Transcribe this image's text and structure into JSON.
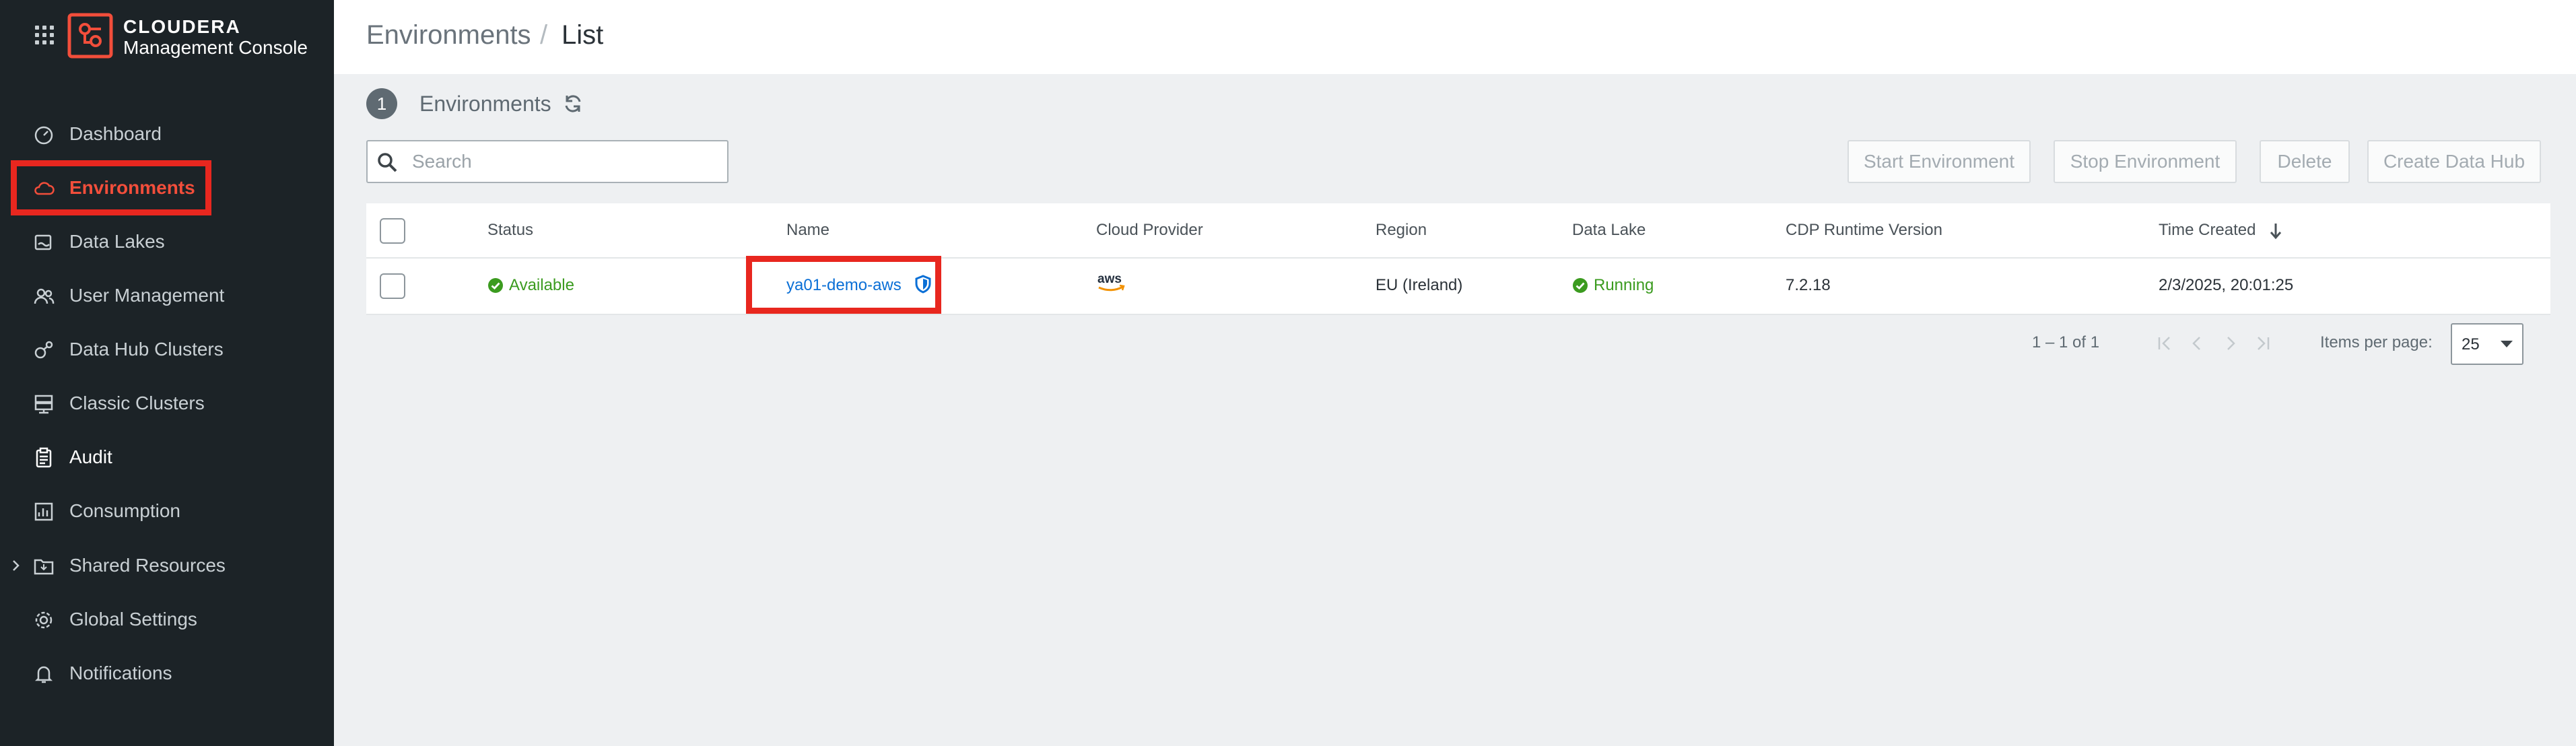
{
  "brand": {
    "name": "CLOUDERA",
    "subtitle": "Management Console"
  },
  "sidebar": {
    "items": [
      {
        "label": "Dashboard",
        "icon": "gauge-icon"
      },
      {
        "label": "Environments",
        "icon": "cloud-icon",
        "active": true
      },
      {
        "label": "Data Lakes",
        "icon": "data-lake-icon"
      },
      {
        "label": "User Management",
        "icon": "users-icon"
      },
      {
        "label": "Data Hub Clusters",
        "icon": "data-hub-icon"
      },
      {
        "label": "Classic Clusters",
        "icon": "server-icon"
      },
      {
        "label": "Audit",
        "icon": "clipboard-icon"
      },
      {
        "label": "Consumption",
        "icon": "chart-icon"
      },
      {
        "label": "Shared Resources",
        "icon": "folder-icon"
      },
      {
        "label": "Global Settings",
        "icon": "gear-icon"
      },
      {
        "label": "Notifications",
        "icon": "bell-icon"
      }
    ]
  },
  "breadcrumb": {
    "parent": "Environments",
    "separator": "/",
    "current": "List"
  },
  "section": {
    "count": "1",
    "title": "Environments"
  },
  "search": {
    "placeholder": "Search"
  },
  "actions": {
    "start": "Start Environment",
    "stop": "Stop Environment",
    "delete": "Delete",
    "create": "Create Data Hub"
  },
  "table": {
    "headers": {
      "status": "Status",
      "name": "Name",
      "cloud": "Cloud Provider",
      "region": "Region",
      "datalake": "Data Lake",
      "runtime": "CDP Runtime Version",
      "created": "Time Created"
    },
    "rows": [
      {
        "status": "Available",
        "name": "ya01-demo-aws",
        "cloud": "aws",
        "region": "EU (Ireland)",
        "datalake": "Running",
        "runtime": "7.2.18",
        "created": "2/3/2025, 20:01:25"
      }
    ]
  },
  "pagination": {
    "range": "1 – 1 of 1",
    "items_label": "Items per page:",
    "items_value": "25"
  },
  "colors": {
    "accent": "#f24e3b",
    "highlight": "#e8271f",
    "link": "#0a6fd6",
    "success": "#3b9b1f",
    "sidebar_bg": "#1c2327"
  }
}
